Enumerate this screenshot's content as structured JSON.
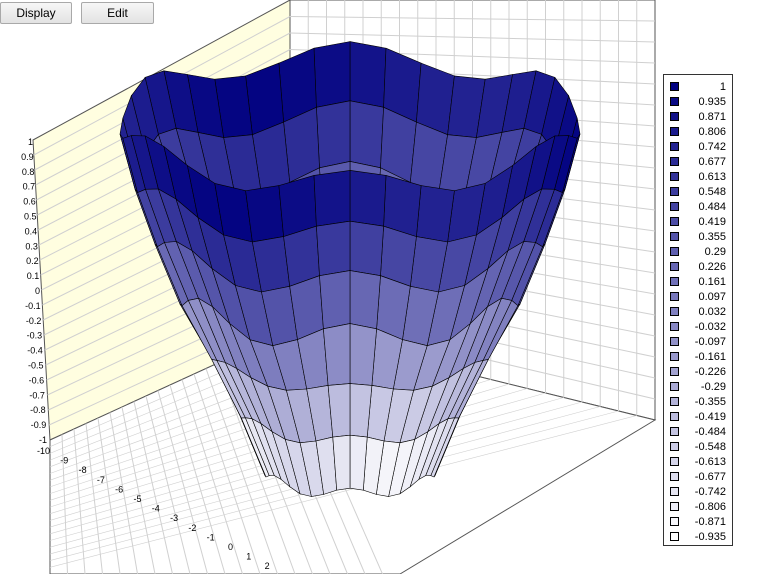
{
  "toolbar": {
    "display_label": "Display",
    "edit_label": "Edit"
  },
  "colors": {
    "high": "#000080",
    "low": "#ffffff",
    "left_wall": "#fffee0",
    "right_wall": "#ffffff",
    "grid": "#d0d0d0"
  },
  "chart_data": {
    "type": "surface",
    "z_ticks": [
      "1",
      "0.9",
      "0.8",
      "0.7",
      "0.6",
      "0.5",
      "0.4",
      "0.3",
      "0.2",
      "0.1",
      "0",
      "-0.1",
      "-0.2",
      "-0.3",
      "-0.4",
      "-0.5",
      "-0.6",
      "-0.7",
      "-0.8",
      "-0.9",
      "-1"
    ],
    "x_ticks": [
      "-10",
      "-9",
      "-8",
      "-7",
      "-6",
      "-5",
      "-4",
      "-3",
      "-2",
      "-1",
      "0",
      "1",
      "2"
    ],
    "zlim": [
      -1,
      1
    ],
    "legend": [
      "1",
      "0.935",
      "0.871",
      "0.806",
      "0.742",
      "0.677",
      "0.613",
      "0.548",
      "0.484",
      "0.419",
      "0.355",
      "0.29",
      "0.226",
      "0.161",
      "0.097",
      "0.032",
      "-0.032",
      "-0.097",
      "-0.161",
      "-0.226",
      "-0.29",
      "-0.355",
      "-0.419",
      "-0.484",
      "-0.548",
      "-0.613",
      "-0.677",
      "-0.742",
      "-0.806",
      "-0.871",
      "-0.935"
    ],
    "grid": true,
    "legend_position": "right"
  }
}
